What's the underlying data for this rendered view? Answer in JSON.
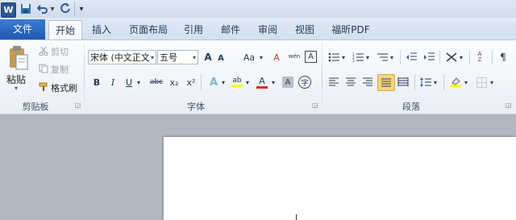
{
  "qat": {
    "app_icon": "W",
    "save_icon": "save-icon",
    "undo_icon": "undo-icon",
    "redo_icon": "redo-icon",
    "customize_icon": "customize-qat-icon"
  },
  "tabs": {
    "file": "文件",
    "home": "开始",
    "insert": "插入",
    "layout": "页面布局",
    "references": "引用",
    "mailings": "邮件",
    "review": "审阅",
    "view": "视图",
    "pdf": "福昕PDF"
  },
  "clipboard": {
    "paste": "粘贴",
    "cut": "剪切",
    "copy": "复制",
    "format_painter": "格式刷",
    "group": "剪贴板"
  },
  "font": {
    "name": "宋体 (中文正文",
    "size": "五号",
    "grow": "A",
    "shrink": "A",
    "case": "Aa",
    "clear": "A",
    "phonetic": "wén",
    "charborder": "A",
    "bold": "B",
    "italic": "I",
    "underline": "U",
    "strike": "abc",
    "sub": "x₂",
    "sup": "x²",
    "effects": "A",
    "highlight": "ab",
    "color": "A",
    "shade": "A",
    "enclose": "字",
    "group": "字体"
  },
  "paragraph": {
    "group": "段落"
  },
  "colors": {
    "accent": "#2b5797",
    "highlight_yellow": "#ffff00",
    "font_red": "#e0262b",
    "active_align": "#f8d67a"
  }
}
